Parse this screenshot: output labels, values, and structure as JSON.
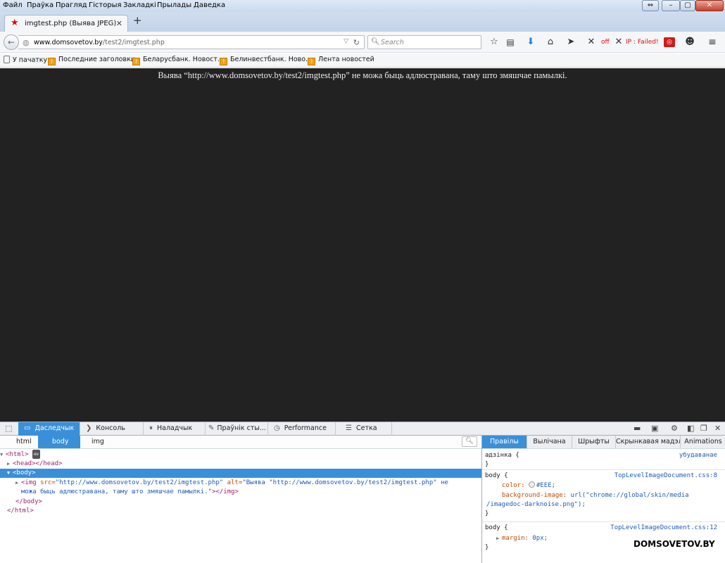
{
  "menubar": {
    "items": [
      "Файл",
      "Праўка",
      "Прагляд",
      "Гісторыя",
      "Закладкі",
      "Прылады",
      "Даведка"
    ]
  },
  "window": {
    "minimize": "–",
    "maximize": "▢",
    "close": "✕",
    "restore": "⇔"
  },
  "tab": {
    "title": "imgtest.php (Выява JPEG)",
    "icon": "star-icon",
    "close": "✕",
    "new": "+"
  },
  "navbar": {
    "url_host": "www.domsovetov.by",
    "url_path": "/test2/imgtest.php",
    "search_placeholder": "Search",
    "addon_off": "off",
    "addon_ip": "IP : Failed!"
  },
  "bookmarks": {
    "items": [
      "У пачатку",
      "Последние заголовки",
      "Беларусбанк. Новост...",
      "Белинвестбанк. Ново...",
      "Лента новостей"
    ]
  },
  "content": {
    "message": "Выява “http://www.domsovetov.by/test2/imgtest.php” не можа быць адлюстравана, таму што змяшчае памылкі.",
    "background": "#222222"
  },
  "devtools": {
    "tabs": [
      "Даследчык",
      "Консоль",
      "Наладчык",
      "Праўнік сты...",
      "Performance",
      "Сетка"
    ],
    "breadcrumbs": [
      "html",
      "body",
      "img"
    ],
    "markup": {
      "html_open": "<html>",
      "ev_badge": "ev",
      "head": "<head></head>",
      "body_open": "<body>",
      "img_tag": "<img",
      "src_attr": "src=",
      "src_val": "\"http://www.domsovetov.by/test2/imgtest.php\"",
      "alt_attr": "alt=",
      "alt_val_1": "\"Выява \"http://www.domsovetov.by/test2/imgtest.php\" не",
      "alt_val_2": "можа быць адлюстравана, таму што змяшчае памылкі.\"",
      "img_close": "></img>",
      "body_close": "</body>",
      "html_close": "</html>"
    },
    "side_tabs": [
      "Правілы",
      "Вылічана",
      "Шрыфты",
      "Скрынкавая мадэль",
      "Animations"
    ],
    "rules": {
      "r1_selector": "адзінка {",
      "r1_source": "убудаванае",
      "r1_close": "}",
      "r2_selector": "body {",
      "r2_source": "TopLevelImageDocument.css:8",
      "r2_color_prop": "color:",
      "r2_color_val": "#EEE;",
      "r2_bg_prop": "background-image:",
      "r2_bg_val_1": "url(\"chrome://global/skin/media",
      "r2_bg_val_2": "/imagedoc-darknoise.png\");",
      "r2_close": "}",
      "r3_selector": "body {",
      "r3_source": "TopLevelImageDocument.css:12",
      "r3_margin_prop": "margin:",
      "r3_margin_val": "0px;",
      "r3_close": "}"
    }
  },
  "watermark": "DOMSOVETOV.BY",
  "colors": {
    "accent": "#3a8fd9",
    "content_bg": "#222222",
    "message_text": "#eeeeee"
  }
}
